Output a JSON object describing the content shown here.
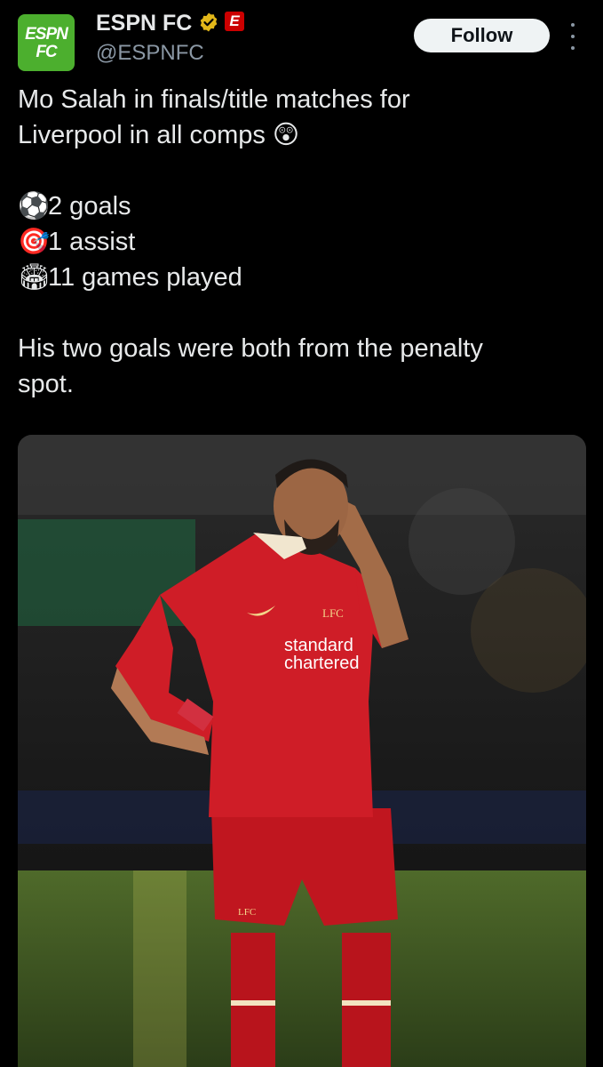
{
  "account": {
    "avatar_line1": "ESPN",
    "avatar_line2": "FC",
    "name": "ESPN FC",
    "handle": "@ESPNFC",
    "badge_letter": "E"
  },
  "follow_label": "Follow",
  "tweet": {
    "line1": "Mo Salah in finals/title matches for",
    "line2": "Liverpool in all comps 😲",
    "stats": [
      {
        "icon": "⚽",
        "text": "2 goals"
      },
      {
        "icon": "🎯",
        "text": "1 assist"
      },
      {
        "icon": "🏟",
        "text": "11 games played"
      }
    ],
    "closing_line1": "His two goals were both from the penalty",
    "closing_line2": "spot."
  },
  "photo": {
    "sponsor_line1": "standard",
    "sponsor_line2": "chartered",
    "crest_text": "LFC"
  }
}
